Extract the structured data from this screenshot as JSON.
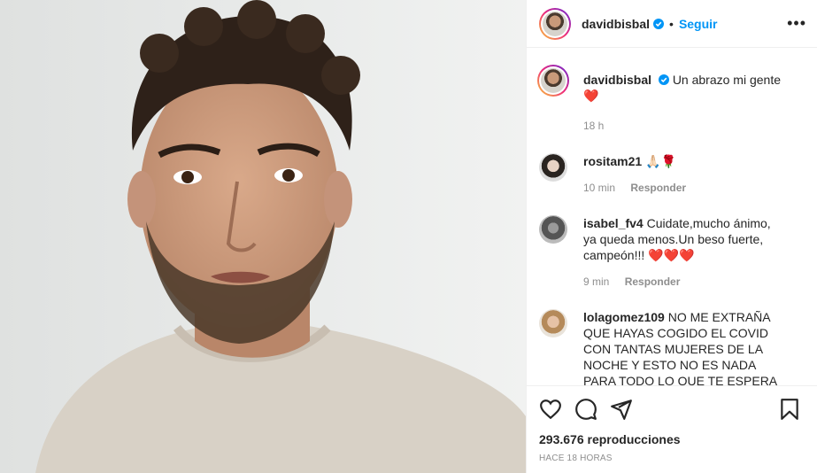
{
  "post": {
    "username": "davidbisbal",
    "follow_label": "Seguir",
    "separator": "•",
    "more_label": "•••",
    "caption": "Un abrazo mi gente",
    "caption_emoji": "❤️",
    "caption_time": "18 h"
  },
  "comments": [
    {
      "user": "rositam21",
      "text": "🙏🏻🌹",
      "time": "10 min",
      "reply": "Responder"
    },
    {
      "user": "isabel_fv4",
      "text": "Cuidate,mucho ánimo, ya queda menos.Un beso fuerte, campeón!!! ❤️❤️❤️",
      "time": "9 min",
      "reply": "Responder"
    },
    {
      "user": "lolagomez109",
      "text": "NO ME EXTRAÑA QUE HAYAS COGIDO EL COVID CON TANTAS MUJERES DE LA NOCHE Y ESTO NO ES NADA PARA TODO LO QUE TE ESPERA POR SER TAN DOBLE CARA CON TANTA FALSEDAD Y ENGAÑAR A TODAS TUS"
    }
  ],
  "footer": {
    "views": "293.676 reproducciones",
    "timestamp": "HACE 18 HORAS"
  },
  "colors": {
    "accent": "#0095f6",
    "heart": "#ed4956",
    "meta": "#8e8e8e"
  }
}
